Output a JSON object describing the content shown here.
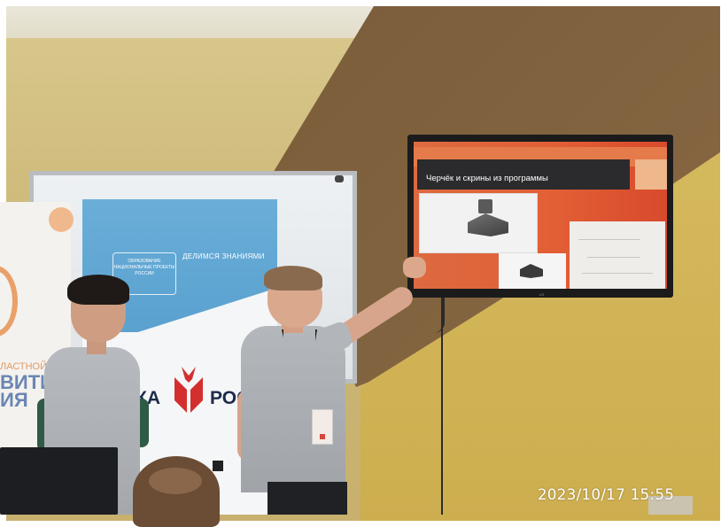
{
  "scene": {
    "description_colors": {
      "wall_yellow": "#d9c98e",
      "wall_brown": "#8a6a44",
      "tv_slide_orange": "#e25f35",
      "title_bar_dark": "#2b2a2c"
    }
  },
  "tv": {
    "slide_title": "Черчёк и скрины из программы",
    "brand": "LG"
  },
  "banners": {
    "left_line1": "ЛАСТНОЙ",
    "left_line2": "ВИТИЯ",
    "left_line3": "ИЯ",
    "national_projects": "ОБРАЗОВАНИЕ НАЦИОНАЛЬНЫЕ ПРОЕКТЫ РОССИИ",
    "share_knowledge": "ДЕЛИМСЯ ЗНАНИЯМИ",
    "nauka_part": "КА",
    "ros_part": "РОС"
  },
  "photo": {
    "timestamp": "2023/10/17  15:55"
  }
}
